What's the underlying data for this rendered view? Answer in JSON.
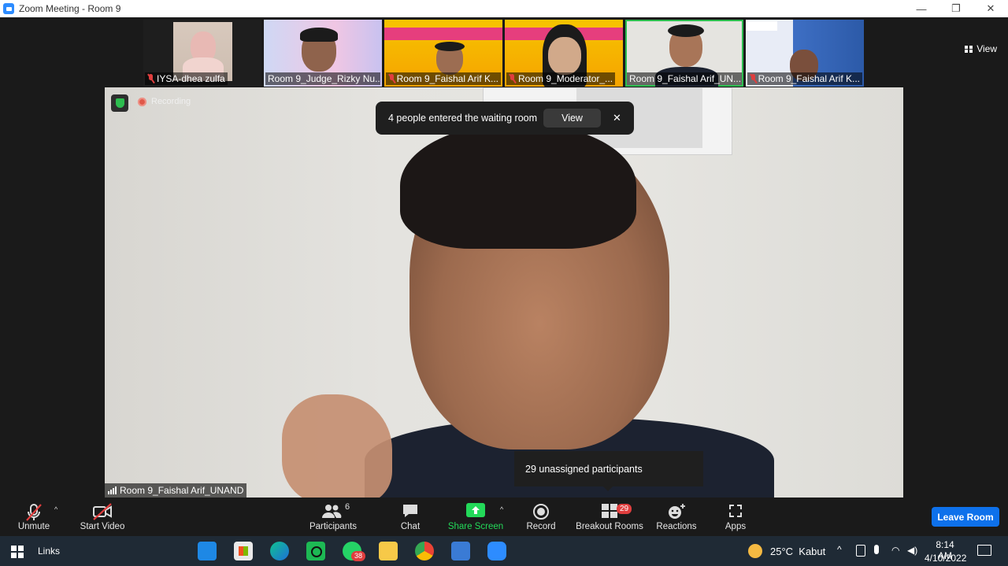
{
  "window": {
    "title": "Zoom Meeting - Room 9",
    "minimize": "—",
    "restore": "❐",
    "close": "✕"
  },
  "gallery": {
    "view_label": "View",
    "tiles": [
      {
        "label": "IYSA-dhea zulfa"
      },
      {
        "label": "Room 9_Judge_Rizky Nu..."
      },
      {
        "label": "Room 9_Faishal Arif K..."
      },
      {
        "label": "Room 9_Moderator_..."
      },
      {
        "label": "Room 9_Faishal Arif_UN..."
      },
      {
        "label": "Room 9_Faishal Arif K..."
      }
    ]
  },
  "video": {
    "recording_label": "Recording",
    "speaker_name": "Room 9_Faishal Arif_UNAND"
  },
  "toast": {
    "message": "4 people entered the waiting room",
    "view_label": "View",
    "close_label": "✕"
  },
  "tooltip": {
    "text": "29 unassigned participants"
  },
  "toolbar": {
    "unmute": "Unmute",
    "start_video": "Start Video",
    "participants": "Participants",
    "participants_count": "6",
    "chat": "Chat",
    "share_screen": "Share Screen",
    "record": "Record",
    "breakout_rooms": "Breakout Rooms",
    "breakout_badge": "29",
    "reactions": "Reactions",
    "apps": "Apps",
    "leave_room": "Leave Room"
  },
  "taskbar": {
    "links": "Links",
    "whatsapp_badge": "38",
    "weather": "25°C  Kabut",
    "time": "8:14 AM",
    "date": "4/10/2022"
  },
  "colors": {
    "accent": "#0e71eb",
    "share_green": "#23d959",
    "mute_red": "#e03e3e"
  }
}
